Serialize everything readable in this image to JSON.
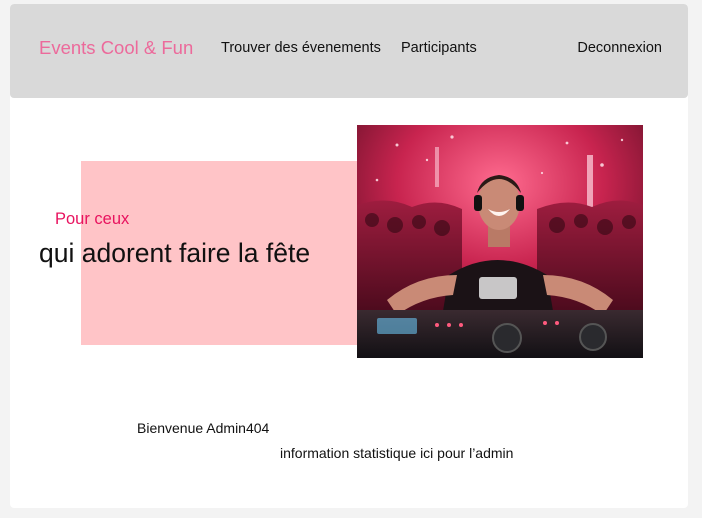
{
  "navbar": {
    "brand": "Events Cool & Fun",
    "links": {
      "events": "Trouver des évenements",
      "participants": "Participants",
      "logout": "Deconnexion"
    }
  },
  "hero": {
    "kicker": "Pour ceux",
    "title": "qui adorent faire la fête"
  },
  "main": {
    "welcome": "Bienvenue Admin404",
    "stats": "information statistique ici pour l’admin"
  },
  "colors": {
    "brand": "#ec6a9b",
    "accent": "#e8135f",
    "hero_block": "#ffc4c7",
    "navbar_bg": "#d9d9d9"
  }
}
